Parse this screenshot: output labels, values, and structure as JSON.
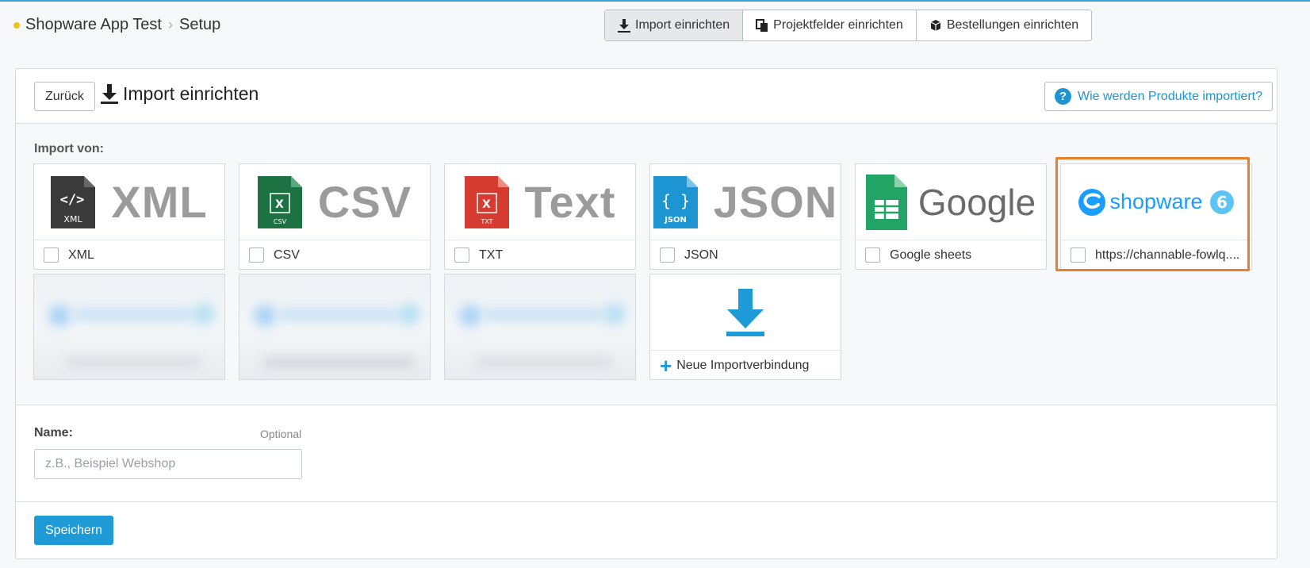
{
  "breadcrumb": {
    "app": "Shopware App Test",
    "page": "Setup"
  },
  "toolbar": {
    "tabs": [
      {
        "label": "Import einrichten",
        "icon": "download-icon",
        "active": true
      },
      {
        "label": "Projektfelder einrichten",
        "icon": "copy-icon",
        "active": false
      },
      {
        "label": "Bestellungen einrichten",
        "icon": "box-icon",
        "active": false
      }
    ]
  },
  "card": {
    "back_label": "Zurück",
    "title": "Import einrichten",
    "help_label": "Wie werden Produkte importiert?"
  },
  "import": {
    "label": "Import von:",
    "sources": [
      {
        "logo_text": "XML",
        "label": "XML",
        "icon_caption": "XML",
        "checked": false
      },
      {
        "logo_text": "CSV",
        "label": "CSV",
        "icon_caption": "CSV",
        "checked": false
      },
      {
        "logo_text": "Text",
        "label": "TXT",
        "icon_caption": "TXT",
        "checked": false
      },
      {
        "logo_text": "JSON",
        "label": "JSON",
        "icon_caption": "JSON",
        "checked": false
      },
      {
        "logo_text": "Google",
        "label": "Google sheets",
        "checked": false
      },
      {
        "logo_text": "shopware",
        "label": "https://channable-fowlq....",
        "checked": false,
        "highlighted": true
      }
    ],
    "new_connection_label": "Neue Importverbindung"
  },
  "form": {
    "name_label": "Name:",
    "optional_label": "Optional",
    "name_placeholder": "z.B., Beispiel Webshop",
    "name_value": "",
    "save_label": "Speichern"
  },
  "colors": {
    "accent": "#1e9ad6",
    "highlight": "#e87e2f",
    "breadcrumb_dot": "#f0c21e",
    "xml_icon": "#3a3a3a",
    "csv_icon": "#1d7243",
    "txt_icon": "#d53b2e",
    "json_icon": "#1e95d3",
    "google_icon": "#21a464"
  }
}
